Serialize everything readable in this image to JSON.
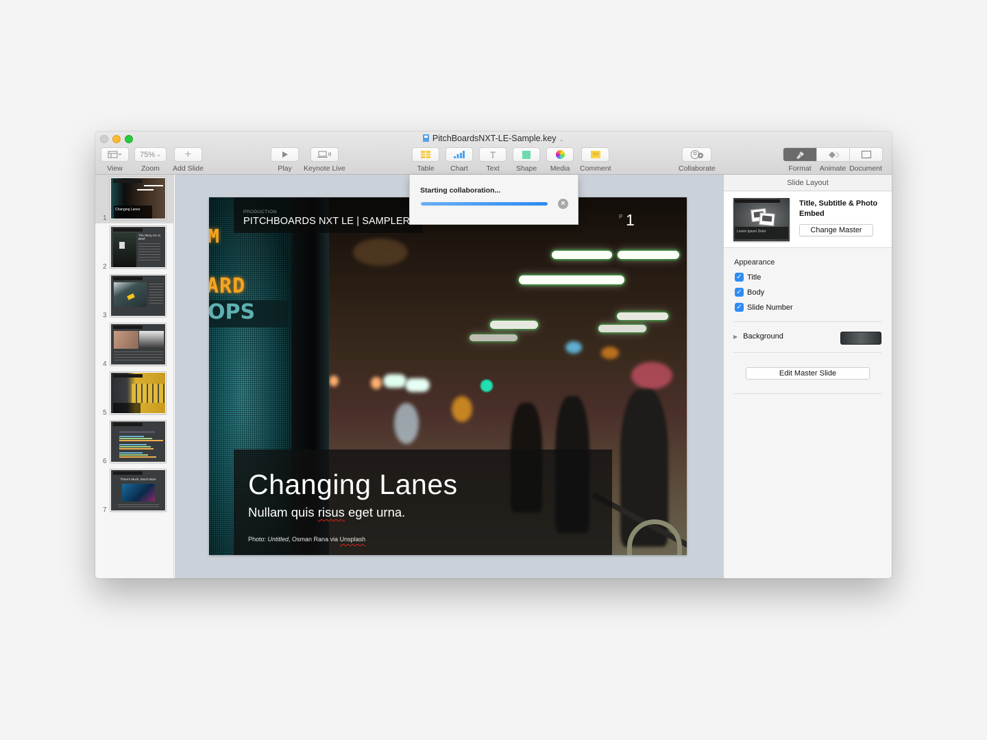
{
  "window": {
    "title": "PitchBoardsNXT-LE-Sample.key"
  },
  "toolbar": {
    "view_label": "View",
    "zoom_value": "75%",
    "zoom_label": "Zoom",
    "add_slide_label": "Add Slide",
    "play_label": "Play",
    "keynote_live_label": "Keynote Live",
    "table_label": "Table",
    "chart_label": "Chart",
    "text_label": "Text",
    "shape_label": "Shape",
    "media_label": "Media",
    "comment_label": "Comment",
    "collaborate_label": "Collaborate",
    "format_label": "Format",
    "animate_label": "Animate",
    "document_label": "Document",
    "active_inspector_tab": "Format"
  },
  "navigator": {
    "selected_slide": 1,
    "slides": [
      {
        "number": "1",
        "title": "Changing Lanes"
      },
      {
        "number": "2",
        "title": "The Story Arc in Brief"
      },
      {
        "number": "3",
        "title": ""
      },
      {
        "number": "4",
        "title": ""
      },
      {
        "number": "5",
        "title": ""
      },
      {
        "number": "6",
        "title": ""
      },
      {
        "number": "7",
        "title": "There's Much, Much More"
      }
    ]
  },
  "slide": {
    "kicker": "PRODUCTION",
    "header": "PITCHBOARDS NXT LE | SAMPLER",
    "slide_number_prefix": "P",
    "slide_number": "1",
    "led_text_1": "M",
    "led_text_2": "ARD",
    "sign_text": "OPS",
    "title": "Changing Lanes",
    "subtitle_pre": "Nullam quis ",
    "subtitle_misspelled": "risus",
    "subtitle_post": " eget urna.",
    "credit_prefix": "Photo: ",
    "credit_work": "Untitled",
    "credit_mid": ", Osman Rana via ",
    "credit_source": "Unsplash"
  },
  "popover": {
    "message": "Starting collaboration...",
    "progress_percent": 100
  },
  "inspector": {
    "header": "Slide Layout",
    "layout_name": "Title, Subtitle & Photo Embed",
    "layout_thumb_text": "Lorem Ipsum Dolor",
    "change_master_label": "Change Master",
    "appearance_label": "Appearance",
    "checkboxes": [
      {
        "label": "Title",
        "checked": true
      },
      {
        "label": "Body",
        "checked": true
      },
      {
        "label": "Slide Number",
        "checked": true
      }
    ],
    "background_label": "Background",
    "background_color": "#4a4f51",
    "edit_master_label": "Edit Master Slide"
  },
  "colors": {
    "accent": "#2f8cf5",
    "canvas": "#cbd1d9"
  }
}
